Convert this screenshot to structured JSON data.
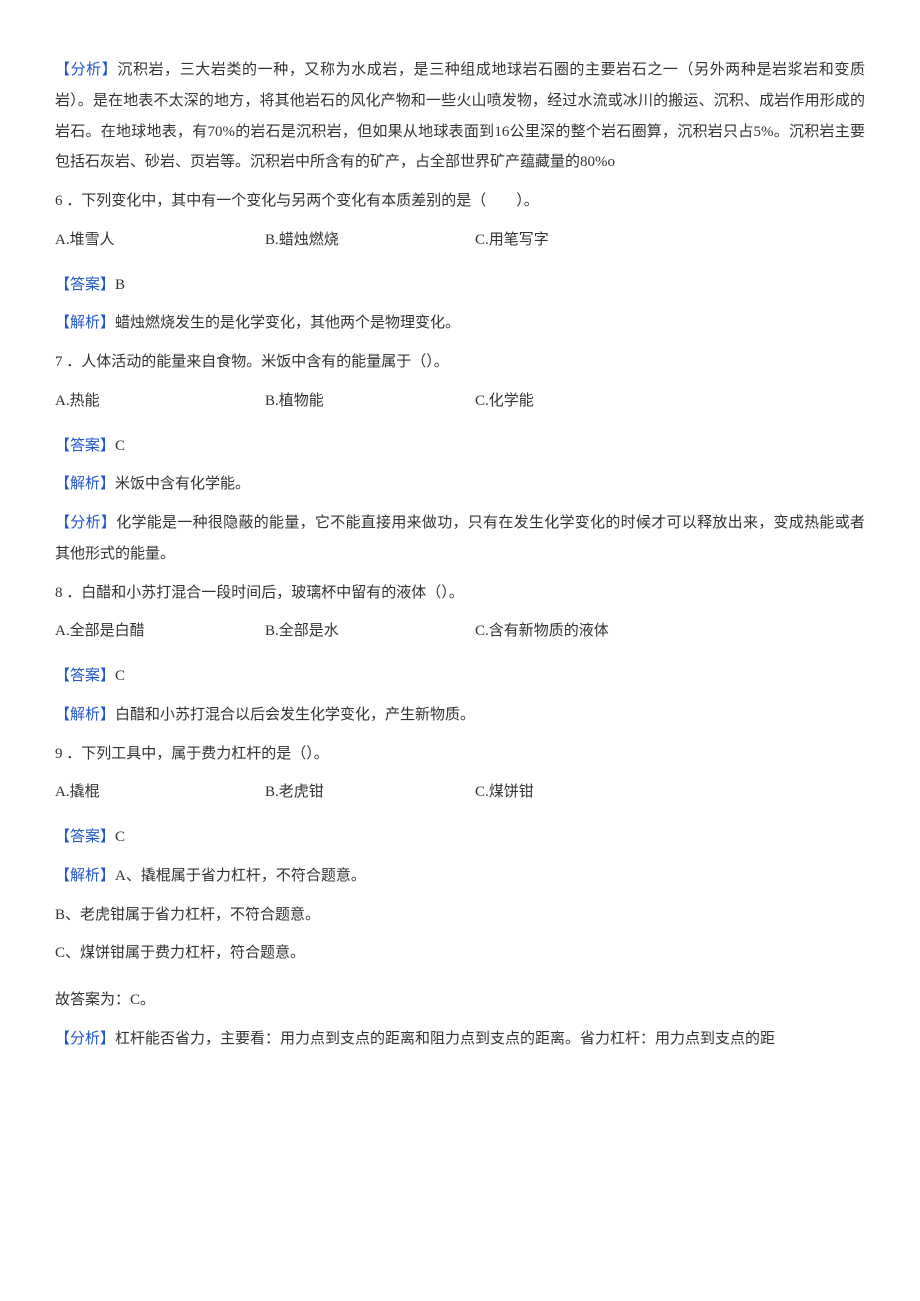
{
  "intro": {
    "analysis_label": "【分析】",
    "analysis_text": "沉积岩，三大岩类的一种，又称为水成岩，是三种组成地球岩石圈的主要岩石之一（另外两种是岩浆岩和变质岩）。是在地表不太深的地方，将其他岩石的风化产物和一些火山喷发物，经过水流或冰川的搬运、沉积、成岩作用形成的岩石。在地球地表，有70%的岩石是沉积岩，但如果从地球表面到16公里深的整个岩石圈算，沉积岩只占5%。沉积岩主要包括石灰岩、砂岩、页岩等。沉积岩中所含有的矿产，占全部世界矿产蕴藏量的80%o"
  },
  "q6": {
    "stem": "6 ．下列变化中，其中有一个变化与另两个变化有本质差别的是（　　）。",
    "optA": "A.堆雪人",
    "optB": "B.蜡烛燃烧",
    "optC": "C.用笔写字",
    "ans_label": "【答案】",
    "ans_value": "B",
    "exp_label": "【解析】",
    "exp_text": "蜡烛燃烧发生的是化学变化，其他两个是物理变化。"
  },
  "q7": {
    "stem": "7 ．人体活动的能量来自食物。米饭中含有的能量属于（）。",
    "optA": "A.热能",
    "optB": "B.植物能",
    "optC": "C.化学能",
    "ans_label": "【答案】",
    "ans_value": "C",
    "exp_label": "【解析】",
    "exp_text": "米饭中含有化学能。",
    "ana_label": "【分析】",
    "ana_text": "化学能是一种很隐蔽的能量，它不能直接用来做功，只有在发生化学变化的时候才可以释放出来，变成热能或者其他形式的能量。"
  },
  "q8": {
    "stem": "8 ．白醋和小苏打混合一段时间后，玻璃杯中留有的液体（）。",
    "optA": "A.全部是白醋",
    "optB": "B.全部是水",
    "optC": "C.含有新物质的液体",
    "ans_label": "【答案】",
    "ans_value": "C",
    "exp_label": "【解析】",
    "exp_text": "白醋和小苏打混合以后会发生化学变化，产生新物质。"
  },
  "q9": {
    "stem": "9 ．下列工具中，属于费力杠杆的是（）。",
    "optA": "A.撬棍",
    "optB": "B.老虎钳",
    "optC": "C.煤饼钳",
    "ans_label": "【答案】",
    "ans_value": "C",
    "exp_label": "【解析】",
    "exp_lineA": "A、撬棍属于省力杠杆，不符合题意。",
    "exp_lineB": "B、老虎钳属于省力杠杆，不符合题意。",
    "exp_lineC": "C、煤饼钳属于费力杠杆，符合题意。",
    "conclusion": "故答案为：C。",
    "ana_label": "【分析】",
    "ana_text": "杠杆能否省力，主要看：用力点到支点的距离和阻力点到支点的距离。省力杠杆：用力点到支点的距"
  }
}
